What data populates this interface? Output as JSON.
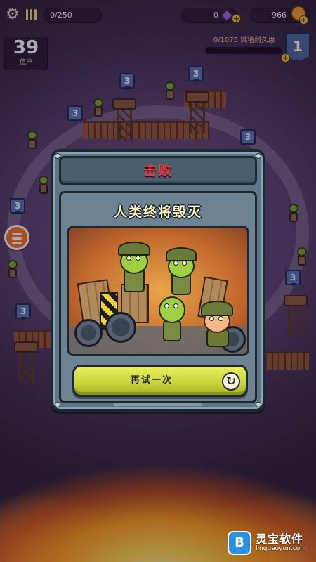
{
  "hud": {
    "ammo": "0/250",
    "gems": "0",
    "gem_plus": "+",
    "coins": "966",
    "coin_plus": "+",
    "wave_number": "39",
    "wave_label": "億户",
    "progress_text": "0/1075 城墙耐久度",
    "progress_fraction": 0.0,
    "rank": "1",
    "rank_plus": "+"
  },
  "map": {
    "tower_levels": [
      "3",
      "3",
      "3",
      "3",
      "3",
      "3",
      "3"
    ]
  },
  "dialog": {
    "title": "击败",
    "subtitle": "人类终将毁灭",
    "retry_label": "再试一次",
    "retry_icon": "↻"
  },
  "watermark": {
    "logo": "B",
    "name": "灵宝软件",
    "url": "lingbaoyun.com"
  },
  "icons": {
    "settings": "gear-icon",
    "ammo": "bullets-icon",
    "gem": "purple-gem-icon",
    "coin": "coin-icon",
    "menu": "hamburger-icon",
    "retry": "retry-icon"
  },
  "colors": {
    "title_red": "#e83a4a",
    "retry_button": "#c7d43a",
    "menu_button": "#f4742a",
    "panel": "#5f7688"
  }
}
